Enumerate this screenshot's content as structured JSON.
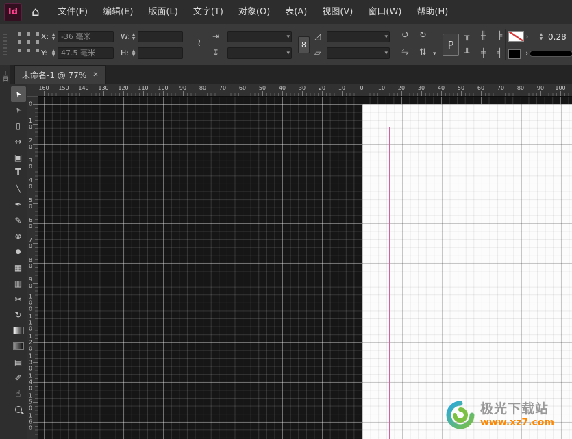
{
  "app": {
    "logo_text": "Id"
  },
  "menubar": {
    "items": [
      "文件(F)",
      "编辑(E)",
      "版面(L)",
      "文字(T)",
      "对象(O)",
      "表(A)",
      "视图(V)",
      "窗口(W)",
      "帮助(H)"
    ]
  },
  "glyphs": {
    "home": "⌂",
    "close": "✕",
    "dropdown": "▾",
    "stepper_up": "▲",
    "stepper_down": "▼",
    "chain": "≀",
    "fit_width": "⇥",
    "fit_height": "↧",
    "shear_top": "◿",
    "shear_bottom": "▱",
    "rotate_ccw": "↺",
    "rotate_cw": "↻",
    "flip_h": "⇋",
    "flip_v": "⇅",
    "flip_dd": "▾",
    "align_1": "╥",
    "align_2": "╫",
    "align_3": "╞",
    "align_4": "╨",
    "align_5": "╪",
    "align_6": "╡",
    "more_arrow": "›"
  },
  "control_panel": {
    "x_label": "X:",
    "x_value": "-36 毫米",
    "y_label": "Y:",
    "y_value": "47.5 毫米",
    "w_label": "W:",
    "w_value": "",
    "h_label": "H:",
    "h_value": "",
    "scale_x_value": "",
    "scale_y_value": "",
    "rotate_value": "",
    "shear_value": "",
    "constrain": "8",
    "p_badge": "P",
    "stroke_weight": "0.28"
  },
  "tabbar": {
    "active_tab": "未命名-1 @ 77%"
  },
  "left_dock": {
    "label": "工具"
  },
  "toolbar": {
    "tools": [
      {
        "name": "selection-tool",
        "icon": "selection",
        "selected": true
      },
      {
        "name": "direct-selection-tool",
        "icon": "direct-selection"
      },
      {
        "name": "page-tool",
        "icon": "page"
      },
      {
        "name": "gap-tool",
        "icon": "gap"
      },
      {
        "name": "content-collector-tool",
        "icon": "collector"
      },
      {
        "name": "type-tool",
        "icon": "type"
      },
      {
        "name": "line-tool",
        "icon": "line"
      },
      {
        "name": "pen-tool",
        "icon": "pen"
      },
      {
        "name": "pencil-tool",
        "icon": "pencil"
      },
      {
        "name": "rectangle-frame-tool",
        "icon": "frame"
      },
      {
        "name": "ellipse-tool",
        "icon": "ellipse"
      },
      {
        "name": "grid-tool",
        "icon": "grid"
      },
      {
        "name": "rectangle-tool",
        "icon": "columns"
      },
      {
        "name": "scissors-tool",
        "icon": "scissors"
      },
      {
        "name": "free-transform-tool",
        "icon": "transform"
      },
      {
        "name": "gradient-swatch-tool",
        "icon": "gradient"
      },
      {
        "name": "gradient-feather-tool",
        "icon": "gradient-feather"
      },
      {
        "name": "note-tool",
        "icon": "note"
      },
      {
        "name": "eyedropper-tool",
        "icon": "eyedropper"
      },
      {
        "name": "hand-tool",
        "icon": "hand"
      },
      {
        "name": "zoom-tool",
        "icon": "zoom"
      }
    ]
  },
  "rulers": {
    "horizontal": [
      "160",
      "150",
      "140",
      "130",
      "120",
      "110",
      "100",
      "90",
      "80",
      "70",
      "60",
      "50",
      "40",
      "30",
      "20",
      "10",
      "0",
      "10",
      "20",
      "30",
      "40",
      "50",
      "60",
      "70",
      "80",
      "90",
      "100"
    ],
    "vertical": [
      "0",
      "10",
      "20",
      "30",
      "40",
      "50",
      "60",
      "70",
      "80",
      "90",
      "100",
      "110",
      "120",
      "130",
      "140",
      "150",
      "160"
    ]
  },
  "watermark": {
    "name": "极光下载站",
    "url": "www.xz7.com"
  },
  "colors": {
    "margin_guide": "#d75f9f",
    "logo_pink": "#ff3f8e",
    "watermark_orange": "#ff8800",
    "watermark_blue": "#29a8df",
    "watermark_green": "#7cc143"
  }
}
